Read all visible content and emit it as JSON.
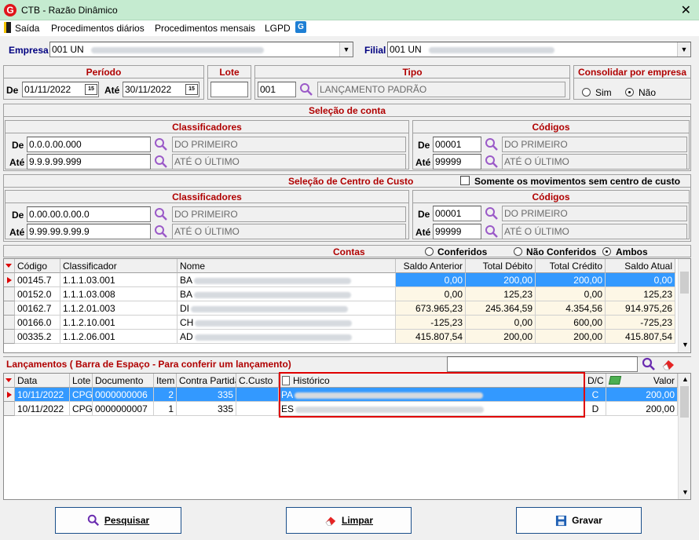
{
  "window": {
    "title": "CTB - Razão Dinâmico",
    "close": "✕"
  },
  "menu": {
    "items": [
      "Saída",
      "Procedimentos diários",
      "Procedimentos mensais",
      "LGPD"
    ]
  },
  "empresa": {
    "label": "Empresa",
    "value": "001 UN"
  },
  "filial": {
    "label": "Filial",
    "value": "001 UN"
  },
  "periodo": {
    "title": "Período",
    "de_label": "De",
    "de_value": "01/11/2022",
    "ate_label": "Até",
    "ate_value": "30/11/2022"
  },
  "lote": {
    "title": "Lote",
    "value": ""
  },
  "tipo": {
    "title": "Tipo",
    "code": "001",
    "desc": "LANÇAMENTO PADRÃO"
  },
  "consolidar": {
    "title": "Consolidar por empresa",
    "sim": "Sim",
    "nao": "Não",
    "selected": "nao"
  },
  "selecao_conta": {
    "title": "Seleção de conta",
    "classificadores": {
      "title": "Classificadores",
      "de_label": "De",
      "de_value": "0.0.0.00.000",
      "de_desc": "DO PRIMEIRO",
      "ate_label": "Até",
      "ate_value": "9.9.9.99.999",
      "ate_desc": "ATÉ O ÚLTIMO"
    },
    "codigos": {
      "title": "Códigos",
      "de_label": "De",
      "de_value": "00001",
      "de_desc": "DO PRIMEIRO",
      "ate_label": "Até",
      "ate_value": "99999",
      "ate_desc": "ATÉ O ÚLTIMO"
    }
  },
  "selecao_cc": {
    "title": "Seleção de Centro de Custo",
    "somente_label": "Somente os movimentos sem centro de custo",
    "classificadores": {
      "title": "Classificadores",
      "de_label": "De",
      "de_value": "0.00.00.0.00.0",
      "de_desc": "DO PRIMEIRO",
      "ate_label": "Até",
      "ate_value": "9.99.99.9.99.9",
      "ate_desc": "ATÉ O ÚLTIMO"
    },
    "codigos": {
      "title": "Códigos",
      "de_label": "De",
      "de_value": "00001",
      "de_desc": "DO PRIMEIRO",
      "ate_label": "Até",
      "ate_value": "99999",
      "ate_desc": "ATÉ O ÚLTIMO"
    }
  },
  "contas": {
    "title": "Contas",
    "filter": {
      "conferidos": "Conferidos",
      "nao_conferidos": "Não Conferidos",
      "ambos": "Ambos",
      "selected": "ambos"
    },
    "headers": [
      "Código",
      "Classificador",
      "Nome",
      "Saldo Anterior",
      "Total Débito",
      "Total Crédito",
      "Saldo Atual"
    ],
    "rows": [
      {
        "codigo": "00145.7",
        "classificador": "1.1.1.03.001",
        "nome": "BA",
        "saldo_anterior": "0,00",
        "total_debito": "200,00",
        "total_credito": "200,00",
        "saldo_atual": "0,00"
      },
      {
        "codigo": "00152.0",
        "classificador": "1.1.1.03.008",
        "nome": "BA",
        "saldo_anterior": "0,00",
        "total_debito": "125,23",
        "total_credito": "0,00",
        "saldo_atual": "125,23"
      },
      {
        "codigo": "00162.7",
        "classificador": "1.1.2.01.003",
        "nome": "DI",
        "saldo_anterior": "673.965,23",
        "total_debito": "245.364,59",
        "total_credito": "4.354,56",
        "saldo_atual": "914.975,26"
      },
      {
        "codigo": "00166.0",
        "classificador": "1.1.2.10.001",
        "nome": "CH",
        "saldo_anterior": "-125,23",
        "total_debito": "0,00",
        "total_credito": "600,00",
        "saldo_atual": "-725,23"
      },
      {
        "codigo": "00335.2",
        "classificador": "1.1.2.06.001",
        "nome": "AD",
        "saldo_anterior": "415.807,54",
        "total_debito": "200,00",
        "total_credito": "200,00",
        "saldo_atual": "415.807,54"
      }
    ]
  },
  "lancamentos": {
    "title": "Lançamentos ( Barra de Espaço - Para conferir um lançamento)",
    "search_value": "",
    "headers": [
      "Data",
      "Lote",
      "Documento",
      "Item",
      "Contra Partida",
      "C.Custo",
      "Histórico",
      "D/C",
      "Valor"
    ],
    "rows": [
      {
        "data": "10/11/2022",
        "lote": "CPG",
        "documento": "0000000006",
        "item": "2",
        "contra": "335",
        "ccusto": "",
        "historico": "PA",
        "dc": "C",
        "valor": "200,00"
      },
      {
        "data": "10/11/2022",
        "lote": "CPG",
        "documento": "0000000007",
        "item": "1",
        "contra": "335",
        "ccusto": "",
        "historico": "ES",
        "dc": "D",
        "valor": "200,00"
      }
    ]
  },
  "buttons": {
    "pesquisar": "Pesquisar",
    "limpar": "Limpar",
    "gravar": "Gravar"
  },
  "colors": {
    "title_bar": "#c5ebd0",
    "accent_red": "#b00000",
    "selection": "#3399ff",
    "highlight_box": "#e00000"
  }
}
